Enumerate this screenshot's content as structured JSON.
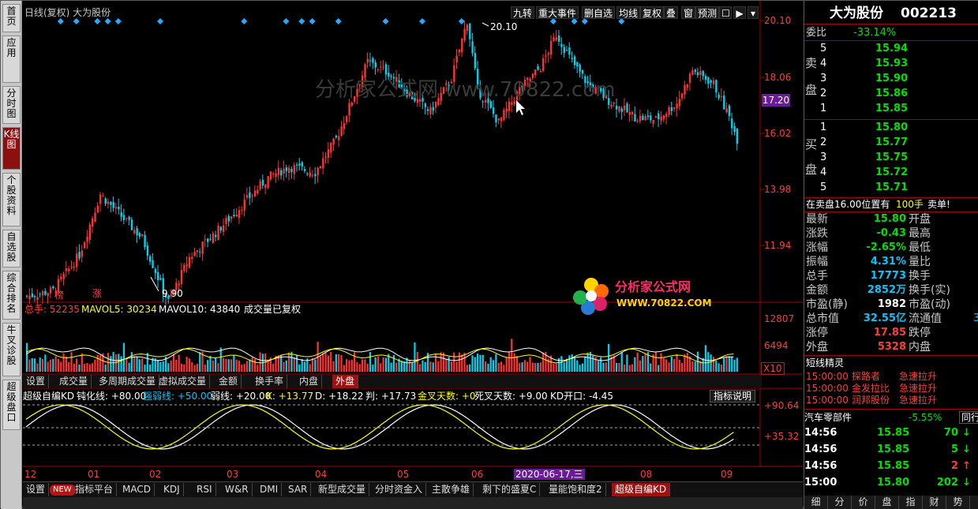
{
  "left_tabs": [
    {
      "label": "首页",
      "active": false
    },
    {
      "label": "应用",
      "active": false
    },
    {
      "label": "分时图",
      "active": false
    },
    {
      "label": "K线图",
      "active": true
    },
    {
      "label": "个股资料",
      "active": false
    },
    {
      "label": "自选股",
      "active": false
    },
    {
      "label": "综合排名",
      "active": false
    },
    {
      "label": "牛叉诊股",
      "active": false
    },
    {
      "label": "超级盘口",
      "active": false
    }
  ],
  "chart_header": {
    "title": "日线(复权) 大为股份"
  },
  "toolbar": [
    "九转",
    "重大事件",
    "删自选",
    "均线",
    "复权",
    "叠",
    "窗",
    "预测"
  ],
  "price_axis": [
    "20.10",
    "18.06",
    "16.02",
    "13.98",
    "11.94"
  ],
  "current_price_tag": "17.20",
  "price_annotations": {
    "high": "20.10",
    "low": "9.90",
    "mark1": "榜",
    "mark2": "涨"
  },
  "volume_header": {
    "total": "总手: 52235",
    "mavol5_label": "MAVOL5: 30234",
    "mavol10_label": "MAVOL10: 43840",
    "note": "成交量已复权"
  },
  "volume_axis": [
    "12807",
    "6494",
    "X10"
  ],
  "volume_tabs": [
    "设置",
    "成交量",
    "多周期成交量",
    "虚拟成交量",
    "金额",
    "换手率",
    "内盘",
    "外盘"
  ],
  "indicator_header": {
    "name": "超级自编KD",
    "dun": "钝化线: +80.00",
    "qiangruo": "强弱线: +50.00",
    "ruo": "弱线: +20.00",
    "k": "K: +13.77",
    "d": "D: +18.22",
    "pan": "判: +17.73",
    "jincha": "金叉天数: +0",
    "sicha": "死叉天数: +9.00",
    "kdopen": "KD开口: -4.45",
    "help": "指标说明"
  },
  "indicator_axis": [
    "+90.64",
    "+35.32"
  ],
  "date_axis": [
    "12",
    "01",
    "02",
    "03",
    "04",
    "05",
    "06",
    "07",
    "08",
    "09"
  ],
  "cursor_date": "2020-06-17,三",
  "bottom_tabs": [
    "设置",
    "NEW",
    "指标平台",
    "MACD",
    "KDJ",
    "RSI",
    "W&R",
    "DMI",
    "SAR",
    "新型成交量",
    "分时资金入",
    "主散争雄",
    "剩下的盛夏C",
    "量能饱和度2",
    "超级自编KD"
  ],
  "watermark": "分析家公式网 www.70822.com",
  "logo": {
    "name": "分析家公式网",
    "url": "WWW.70822.COM"
  },
  "stock": {
    "name": "大为股份",
    "code": "002213"
  },
  "weibi": {
    "label": "委比",
    "value": "-33.14%"
  },
  "sell_label": [
    "卖",
    "盘"
  ],
  "buy_label": [
    "买",
    "盘"
  ],
  "asks": [
    {
      "lvl": "5",
      "price": "15.94"
    },
    {
      "lvl": "4",
      "price": "15.93"
    },
    {
      "lvl": "3",
      "price": "15.90"
    },
    {
      "lvl": "2",
      "price": "15.86"
    },
    {
      "lvl": "1",
      "price": "15.85"
    }
  ],
  "bids": [
    {
      "lvl": "1",
      "price": "15.80"
    },
    {
      "lvl": "2",
      "price": "15.77"
    },
    {
      "lvl": "3",
      "price": "15.75"
    },
    {
      "lvl": "4",
      "price": "15.72"
    },
    {
      "lvl": "5",
      "price": "15.71"
    }
  ],
  "info_line": {
    "text": "在卖盘16.00位置有",
    "qty": "100手",
    "tag": "卖单!"
  },
  "quote": [
    {
      "l": "最新",
      "v": "15.80",
      "r": "开盘",
      "vc": "green"
    },
    {
      "l": "涨跌",
      "v": "-0.43",
      "r": "最高",
      "vc": "green"
    },
    {
      "l": "涨幅",
      "v": "-2.65%",
      "r": "最低",
      "vc": "green"
    },
    {
      "l": "振幅",
      "v": "4.31%",
      "r": "量比",
      "vc": "cyan"
    },
    {
      "l": "总手",
      "v": "17773",
      "r": "换手",
      "vc": "cyan"
    },
    {
      "l": "金额",
      "v": "2852万",
      "r": "换手(实)",
      "vc": "cyan"
    },
    {
      "l": "市盈(静)",
      "v": "1982",
      "r": "市盈(动)",
      "vc": "white"
    },
    {
      "l": "总市值",
      "v": "32.55亿",
      "r": "流通值",
      "vc": "cyan",
      "extra": "3"
    },
    {
      "l": "涨停",
      "v": "17.85",
      "r": "跌停",
      "vc": "red"
    },
    {
      "l": "外盘",
      "v": "5328",
      "r": "内盘",
      "vc": "red"
    }
  ],
  "short_title": "短线精灵",
  "short_items": [
    {
      "time": "15:00:00",
      "name": "探路者",
      "event": "急速拉升"
    },
    {
      "time": "15:00:00",
      "name": "金发拉比",
      "event": "急速拉升"
    },
    {
      "time": "15:00:00",
      "name": "润邦股份",
      "event": "急速拉升"
    }
  ],
  "sector": {
    "name": "汽车零部件",
    "change": "-5.55%",
    "btn": "同行"
  },
  "ticks": [
    {
      "time": "14:56",
      "price": "15.85",
      "vol": "70",
      "dir": "down"
    },
    {
      "time": "14:56",
      "price": "15.85",
      "vol": "5",
      "dir": "down"
    },
    {
      "time": "14:56",
      "price": "15.85",
      "vol": "2",
      "dir": "up"
    },
    {
      "time": "15:00",
      "price": "15.80",
      "vol": "202",
      "dir": "down"
    }
  ],
  "bottom_right_tabs": [
    "细",
    "分",
    "价",
    "盘",
    "指",
    "财",
    "势"
  ],
  "colors": {
    "up": "#ff3232",
    "down": "#00d2f0",
    "ma5": "#ffffff",
    "ma10": "#ffff00"
  }
}
